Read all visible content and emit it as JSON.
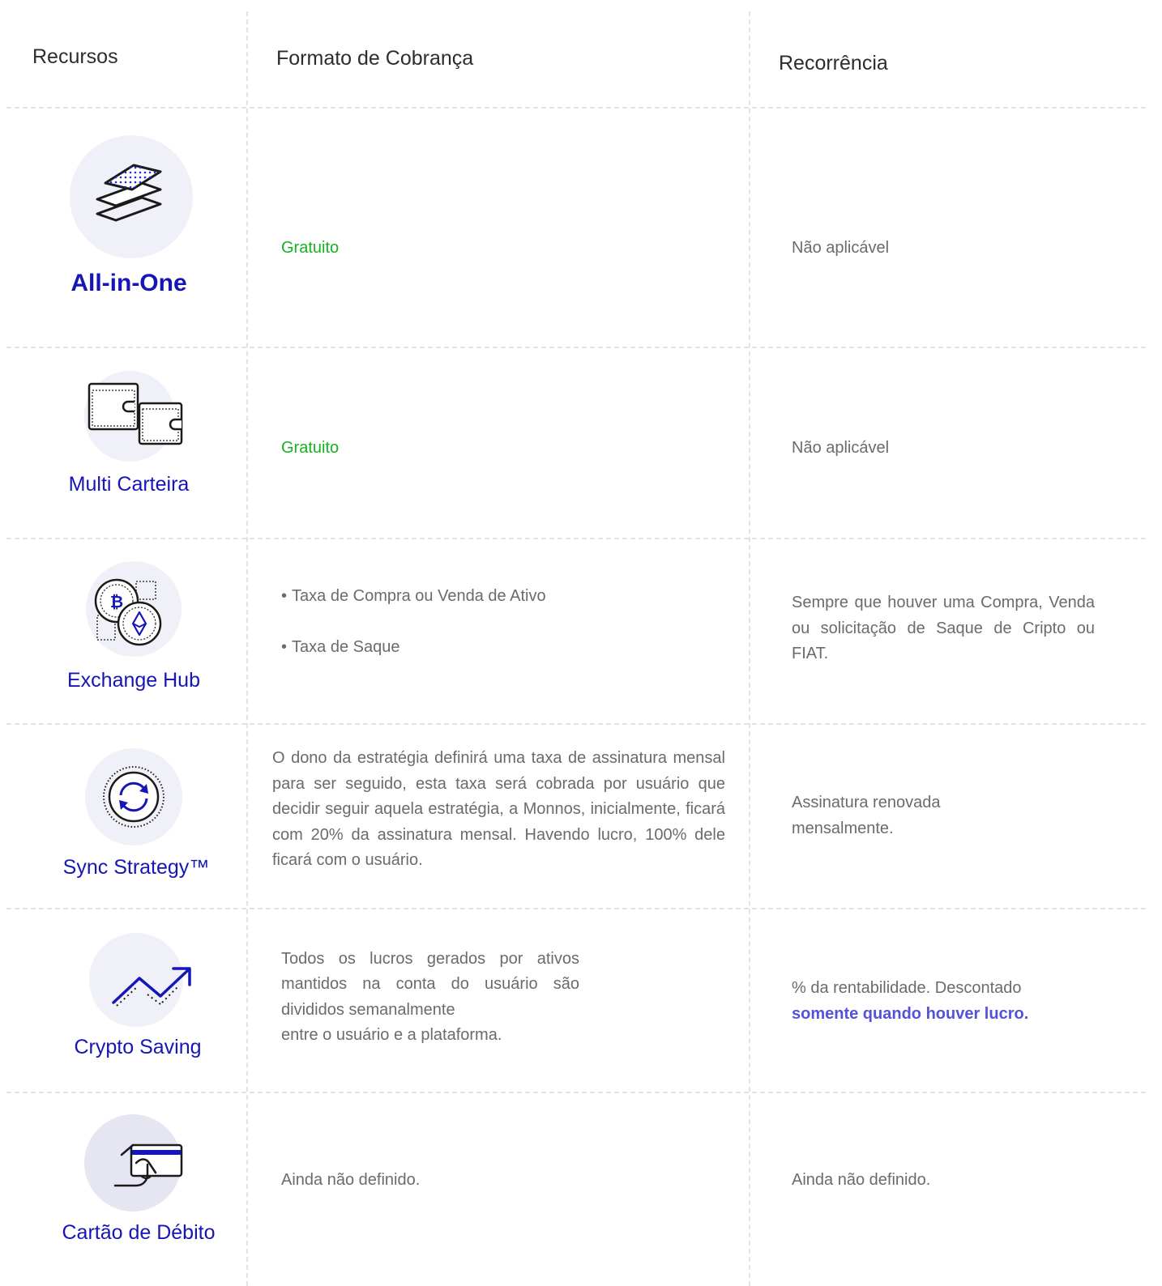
{
  "header": {
    "col1": "Recursos",
    "col2": "Formato de Cobrança",
    "col3": "Recorrência"
  },
  "rows": [
    {
      "icon": "layers-icon",
      "name": "All-in-One",
      "billing": "Gratuito",
      "recurrence": "Não aplicável"
    },
    {
      "icon": "wallets-icon",
      "name": "Multi Carteira",
      "billing": "Gratuito",
      "recurrence": "Não aplicável"
    },
    {
      "icon": "crypto-coins-icon",
      "name": "Exchange Hub",
      "billing_items": [
        "Taxa de Compra ou Venda de Ativo",
        "Taxa de Saque"
      ],
      "recurrence": "Sempre que houver uma Compra, Venda ou solicitação de Saque de Cripto ou FIAT."
    },
    {
      "icon": "sync-icon",
      "name": "Sync Strategy™",
      "billing": "O dono da estratégia definirá uma taxa de assinatura mensal para ser seguido, esta taxa será cobrada por usuário que decidir seguir aquela estratégia, a Monnos, inicialmente, ficará com 20% da assinatura mensal. Havendo lucro, 100% dele ficará com o usuário.",
      "recurrence_lines": [
        "Assinatura renovada",
        "mensalmente."
      ]
    },
    {
      "icon": "trend-up-icon",
      "name": "Crypto Saving",
      "billing_lines": [
        "Todos os lucros gerados por ativos",
        "mantidos na conta do usuário são",
        "divididos semanalmente",
        "entre o usuário e a plataforma."
      ],
      "recurrence": "% da rentabilidade. Descontado",
      "recurrence_highlight": "somente quando houver lucro."
    },
    {
      "icon": "debit-card-icon",
      "name": "Cartão de Débito",
      "billing": "Ainda não definido.",
      "recurrence": "Ainda não definido."
    }
  ],
  "colors": {
    "feature_name": "#1515b8",
    "free_green": "#15b21f",
    "body_text": "#6b6b6b",
    "accent": "#5353d8",
    "icon_circle": "#f0f0f8"
  }
}
